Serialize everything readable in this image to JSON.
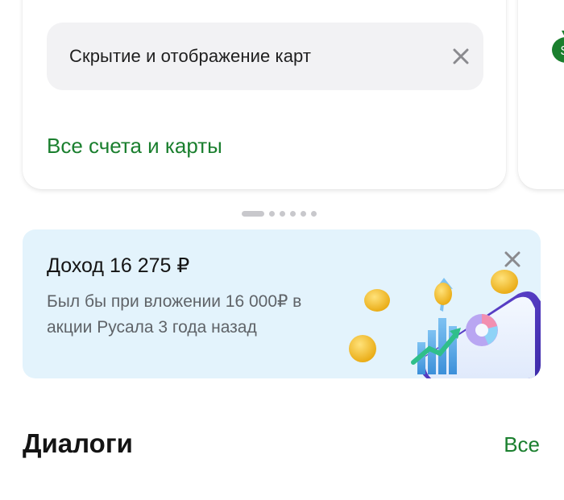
{
  "accounts_card": {
    "hide_cards_label": "Скрытие и отображение карт",
    "all_accounts_link": "Все счета и карты"
  },
  "pager": {
    "total": 6,
    "active": 0
  },
  "promo": {
    "title": "Доход 16 275 ₽",
    "description": "Был бы при вложении 16 000₽ в акции Русала 3 года назад"
  },
  "dialogs": {
    "title": "Диалоги",
    "all_link": "Все"
  },
  "colors": {
    "accent_green": "#1a7f2e",
    "promo_bg": "#e3f3fc",
    "row_bg": "#f2f2f4"
  },
  "icons": {
    "row_close": "close-icon",
    "promo_close": "close-icon",
    "peek": "money-bag-icon"
  }
}
